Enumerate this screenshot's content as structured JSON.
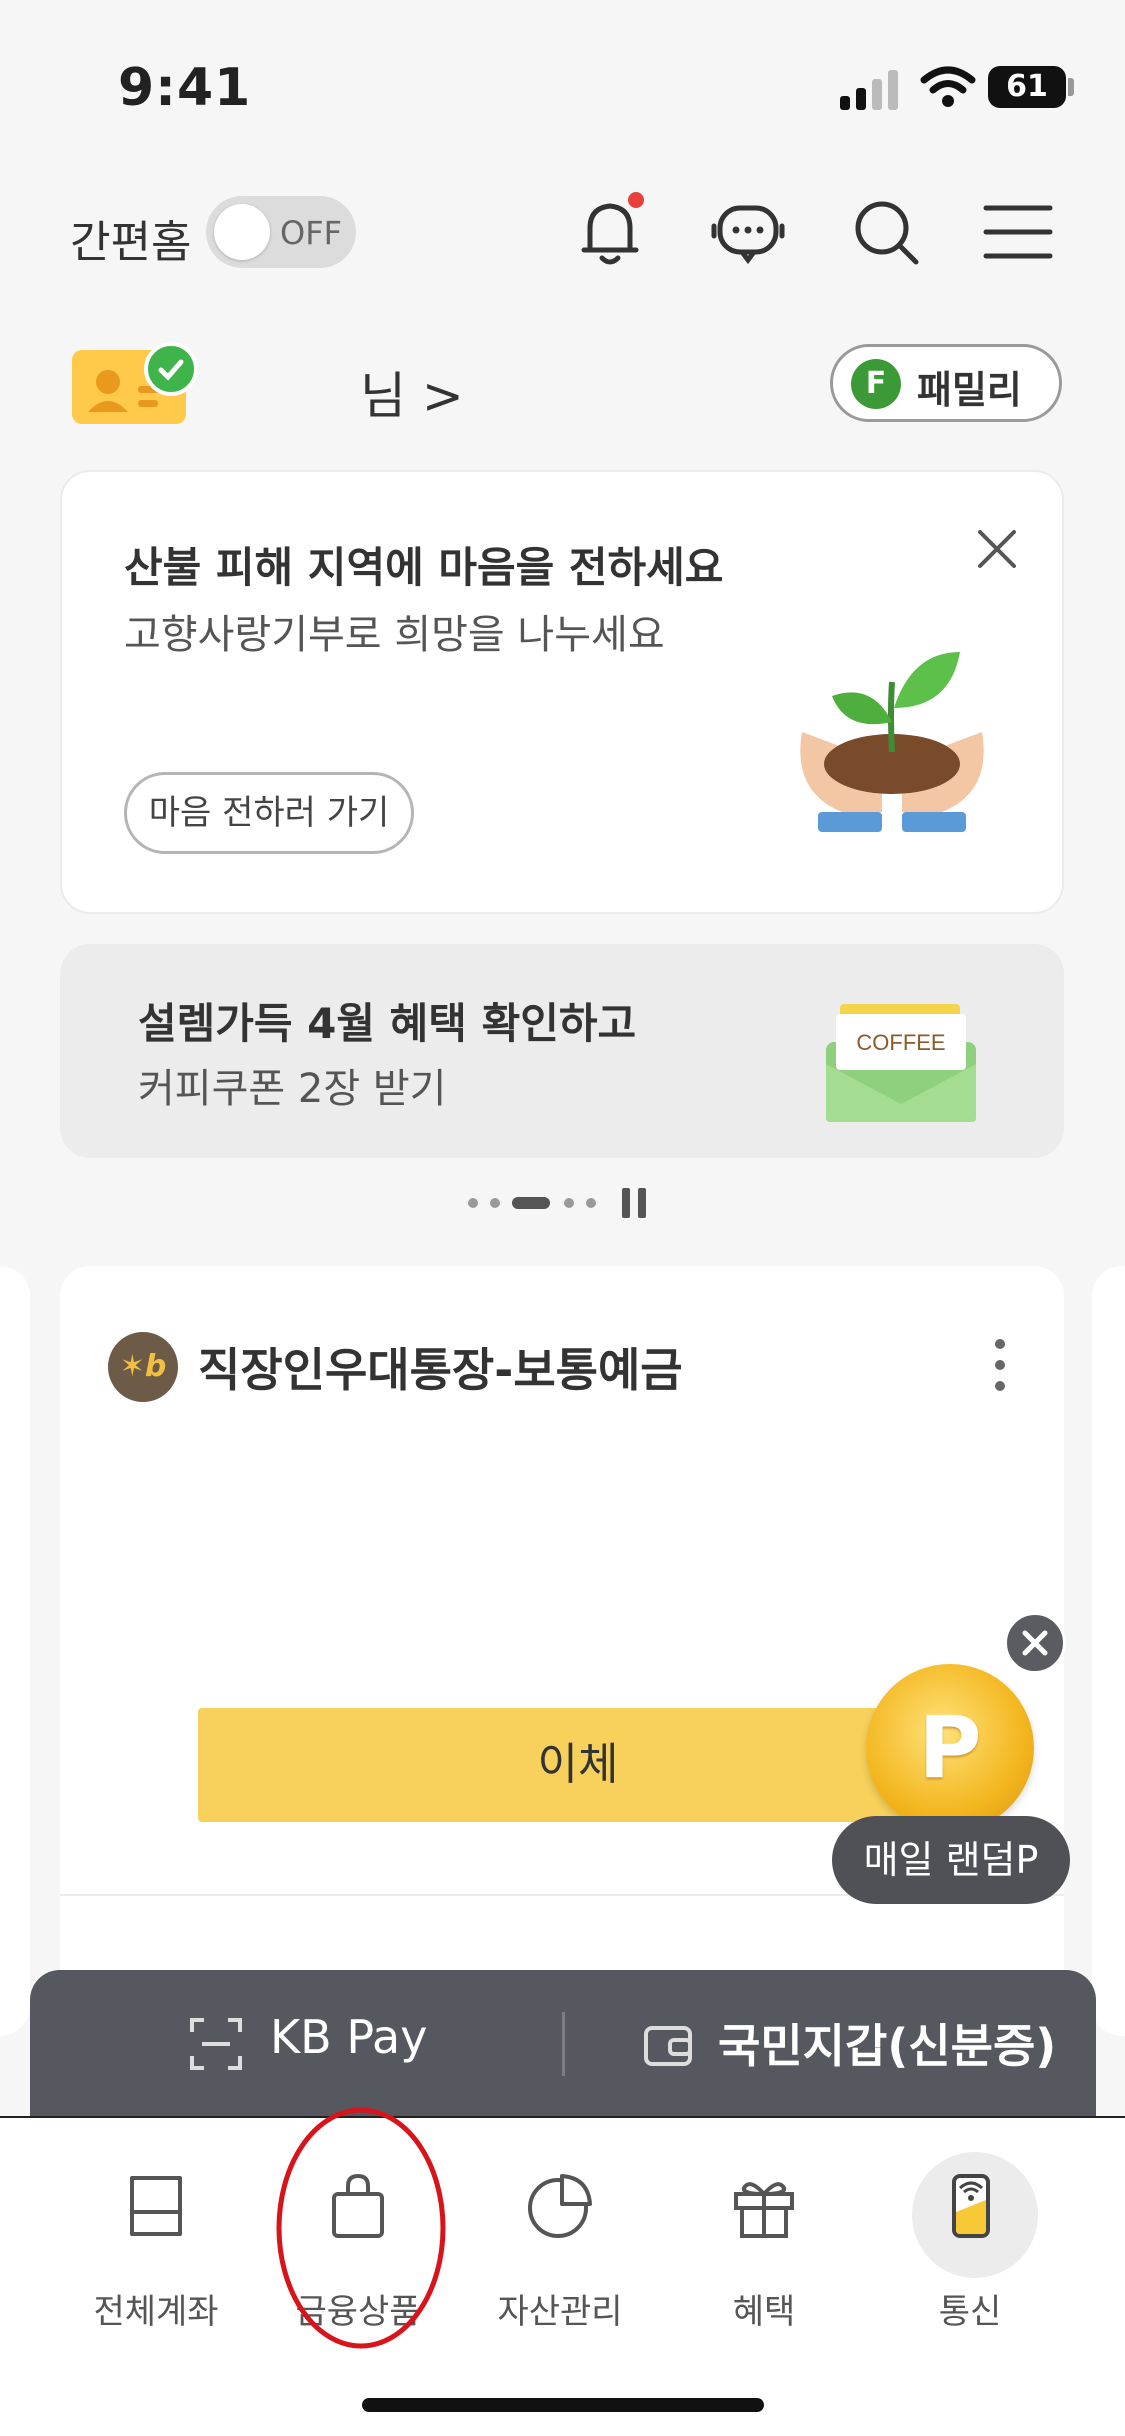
{
  "status_bar": {
    "time": "9:41",
    "battery": "61"
  },
  "header": {
    "simple_home_label": "간편홈",
    "simple_home_toggle": "OFF"
  },
  "profile": {
    "name_suffix": "님 >",
    "family_badge": "F",
    "family_label": "패밀리"
  },
  "banners": [
    {
      "title": "산불 피해 지역에 마음을 전하세요",
      "subtitle": "고향사랑기부로 희망을 나누세요",
      "button": "마음 전하러 가기"
    },
    {
      "title": "설렘가득 4월 혜택 확인하고",
      "subtitle": "커피쿠폰 2장 받기",
      "envelope_text": "COFFEE"
    }
  ],
  "account": {
    "logo_text": "✶b",
    "name": "직장인우대통장-보통예금",
    "transfer_button": "이체"
  },
  "point_promo": {
    "coin_letter": "P",
    "label": "매일 랜덤P"
  },
  "pay_bar": {
    "kbpay": "KB Pay",
    "wallet": "국민지갑(신분증)"
  },
  "bottom_nav": [
    {
      "label": "전체계좌",
      "icon": "account-book-icon"
    },
    {
      "label": "금융상품",
      "icon": "shopping-bag-icon"
    },
    {
      "label": "자산관리",
      "icon": "pie-chart-icon"
    },
    {
      "label": "혜택",
      "icon": "gift-icon"
    },
    {
      "label": "통신",
      "icon": "phone-signal-icon"
    }
  ],
  "colors": {
    "accent_yellow": "#f7d15b",
    "annotation_red": "#d8141b",
    "dark_bar": "#55585e"
  }
}
